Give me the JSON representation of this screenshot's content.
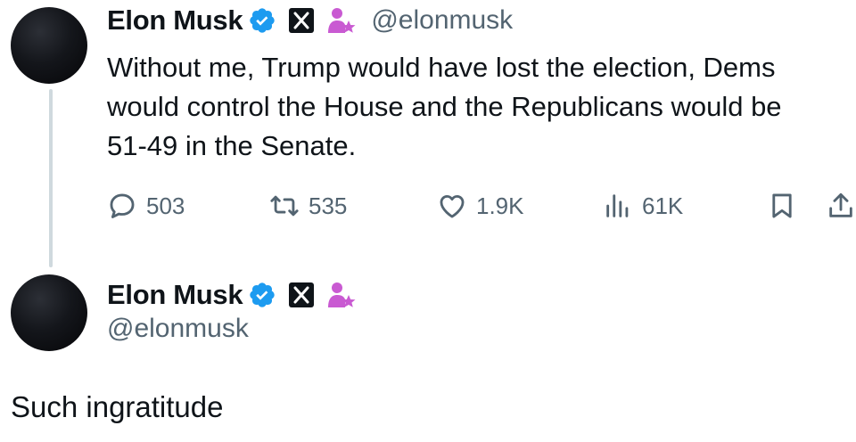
{
  "tweet": {
    "author": {
      "name": "Elon Musk",
      "handle": "@elonmusk",
      "avatar_icon": "avatar-circle",
      "badges": [
        "verified-badge-icon",
        "x-logo-icon",
        "affiliate-badge-icon"
      ]
    },
    "text_lines": [
      "Without me, Trump would have lost the election, Dems",
      "would control the House and the Republicans would be",
      "51-49 in the Senate."
    ],
    "actions": {
      "replies": "503",
      "reposts": "535",
      "likes": "1.9K",
      "views": "61K"
    }
  },
  "reply": {
    "author": {
      "name": "Elon Musk",
      "handle": "@elonmusk"
    },
    "text": "Such ingratitude"
  },
  "colors": {
    "text": "#0f1419",
    "secondary": "#536471",
    "verified_blue": "#1d9bf0",
    "affiliate_purple": "#c95ad2",
    "thread_line": "#cfd9de"
  }
}
